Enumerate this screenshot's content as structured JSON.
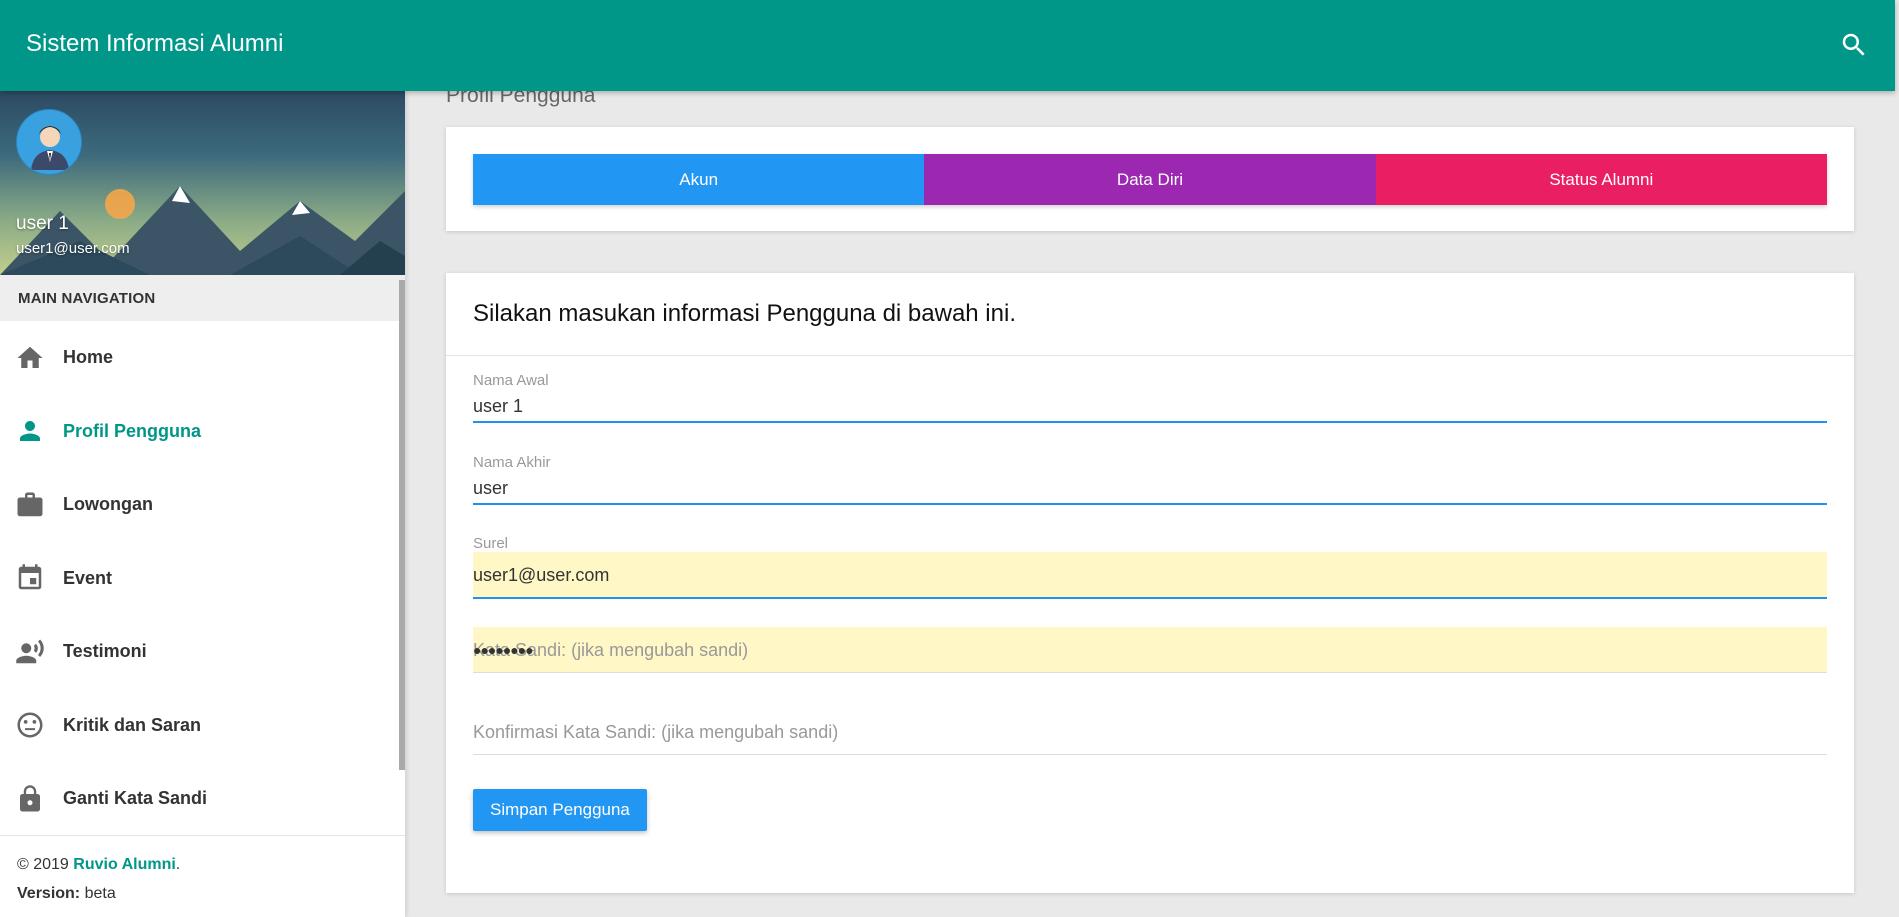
{
  "app": {
    "title": "Sistem Informasi Alumni"
  },
  "topbar": {
    "search_icon": "search-icon"
  },
  "user": {
    "name": "user 1",
    "email": "user1@user.com"
  },
  "sidebar": {
    "header": "MAIN NAVIGATION",
    "items": [
      {
        "label": "Home",
        "icon": "home-icon",
        "active": false
      },
      {
        "label": "Profil Pengguna",
        "icon": "person-icon",
        "active": true
      },
      {
        "label": "Lowongan",
        "icon": "briefcase-icon",
        "active": false
      },
      {
        "label": "Event",
        "icon": "calendar-icon",
        "active": false
      },
      {
        "label": "Testimoni",
        "icon": "record-voice-icon",
        "active": false
      },
      {
        "label": "Kritik dan Saran",
        "icon": "neutral-face-icon",
        "active": false
      },
      {
        "label": "Ganti Kata Sandi",
        "icon": "lock-icon",
        "active": false
      }
    ]
  },
  "footer": {
    "copyright": "© 2019 ",
    "brand": "Ruvio Alumni",
    "period": ".",
    "version_label": "Version:",
    "version_value": " beta"
  },
  "page": {
    "title": "Profil Pengguna"
  },
  "tabs": [
    {
      "label": "Akun"
    },
    {
      "label": "Data Diri"
    },
    {
      "label": "Status Alumni"
    }
  ],
  "form": {
    "heading": "Silakan masukan informasi Pengguna di bawah ini.",
    "first_name": {
      "label": "Nama Awal",
      "value": "user 1"
    },
    "last_name": {
      "label": "Nama Akhir",
      "value": "user"
    },
    "email": {
      "label": "Surel",
      "value": "user1@user.com"
    },
    "password": {
      "placeholder": "Kata Sandi: (jika mengubah sandi)",
      "masked": "●●●●●●●●"
    },
    "password_confirm": {
      "placeholder": "Konfirmasi Kata Sandi: (jika mengubah sandi)"
    },
    "submit_label": "Simpan Pengguna"
  },
  "colors": {
    "primary": "#009688",
    "tab_akun": "#2196f3",
    "tab_data_diri": "#9c27b0",
    "tab_status": "#e91e63",
    "button": "#2196f3"
  }
}
